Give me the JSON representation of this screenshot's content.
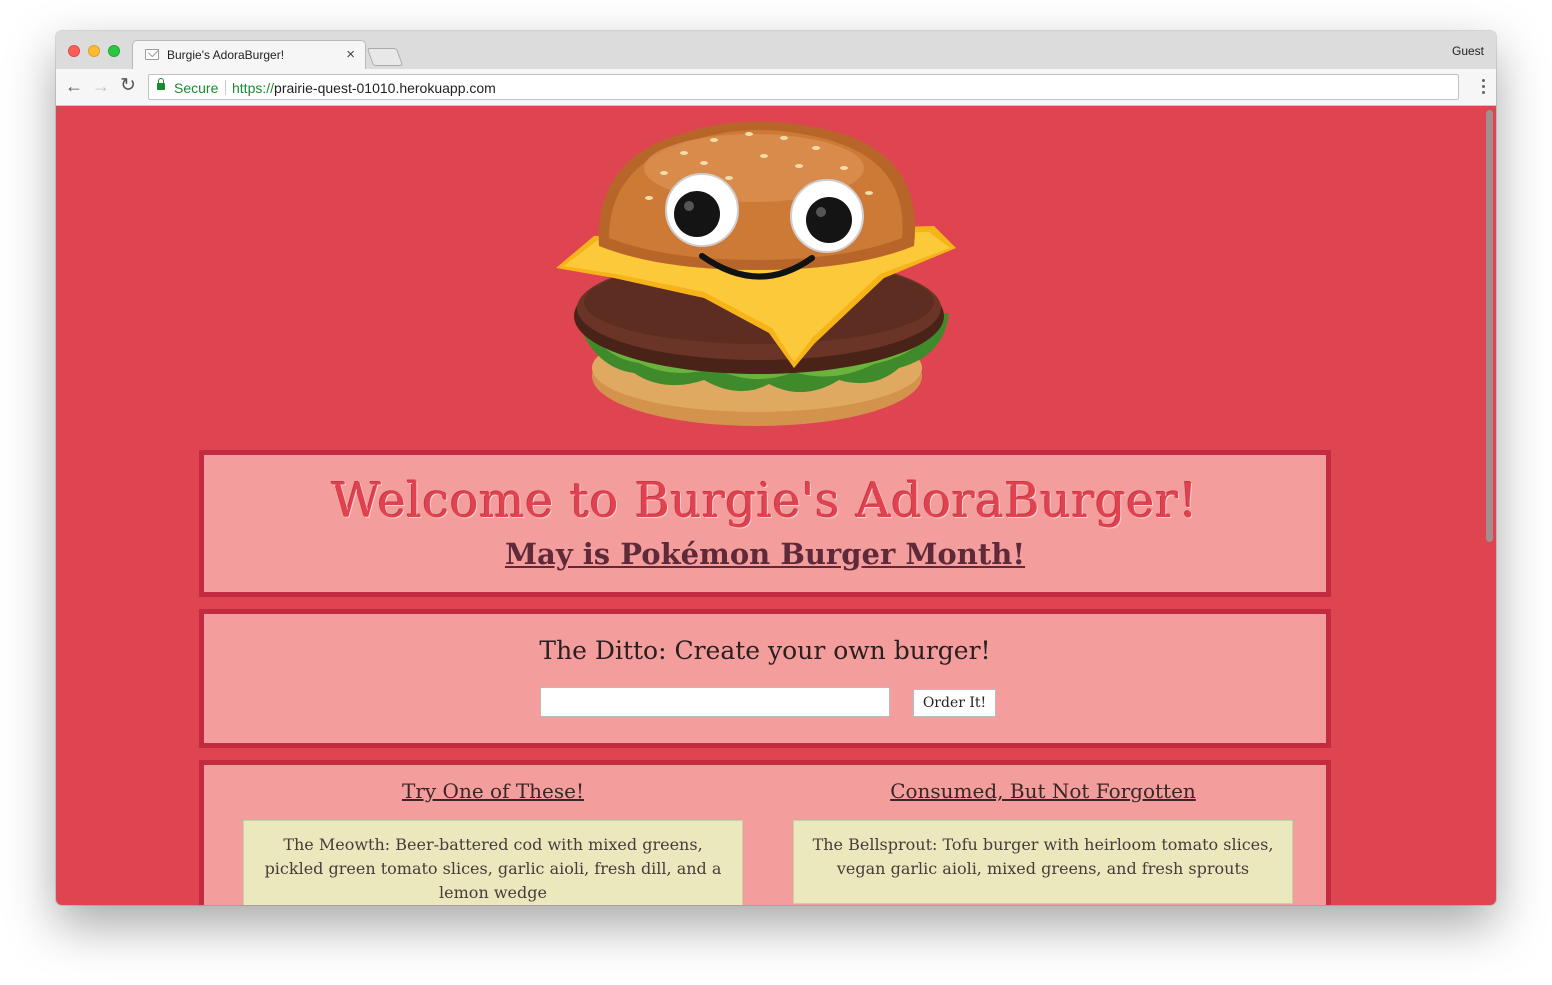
{
  "browser": {
    "tab_title": "Burgie's AdoraBurger!",
    "tab_close": "×",
    "profile": "Guest",
    "secure_label": "Secure",
    "url_scheme": "https://",
    "url_host": "prairie-quest-01010.herokuapp.com",
    "icons": [
      "back-icon",
      "forward-icon",
      "reload-icon",
      "lock-icon",
      "menu-icon",
      "envelope-favicon-icon"
    ]
  },
  "page": {
    "welcome_title": "Welcome to Burgie's AdoraBurger!",
    "welcome_subtitle": "May is Pokémon Burger Month!",
    "ditto_title": "The Ditto: Create your own burger!",
    "ditto_input_value": "",
    "order_button": "Order It!",
    "left_column_heading": "Try One of These!",
    "right_column_heading": "Consumed, But Not Forgotten",
    "available_burgers": [
      "The Meowth: Beer-battered cod with mixed greens, pickled green tomato slices, garlic aioli, fresh dill, and a lemon wedge"
    ],
    "devoured_burgers": [
      "The Bellsprout: Tofu burger with heirloom tomato slices, vegan garlic aioli, mixed greens, and fresh sprouts"
    ]
  },
  "colors": {
    "page_background": "#df4550",
    "panel_background": "#f39d9c",
    "panel_border": "#c32c40",
    "card_background": "#ebe8bd"
  }
}
